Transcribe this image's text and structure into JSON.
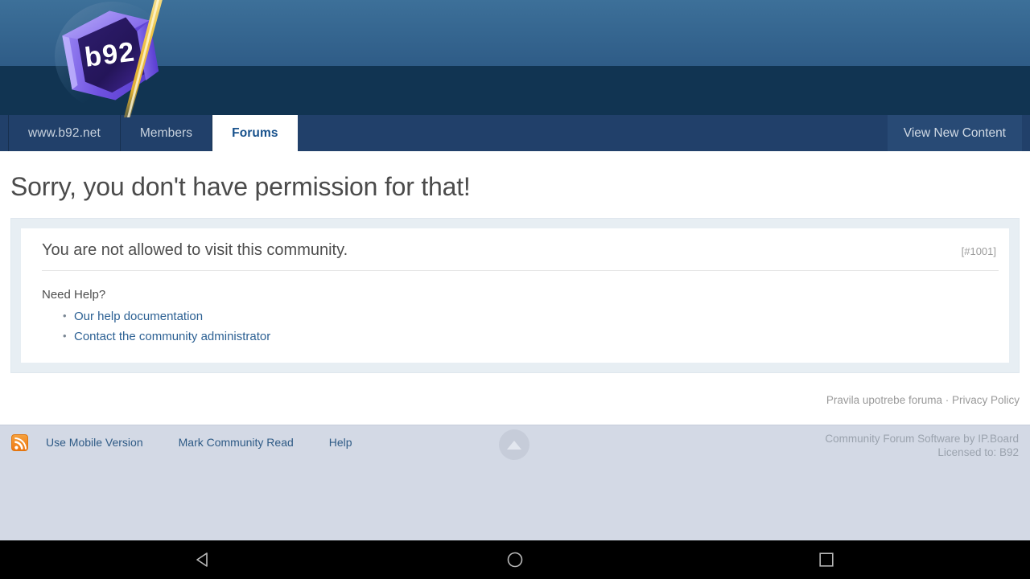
{
  "header": {
    "logo_alt": "b92-logo",
    "logo_text": "b92"
  },
  "nav": {
    "tabs": [
      {
        "label": "www.b92.net",
        "active": false,
        "name": "tab-www-b92-net"
      },
      {
        "label": "Members",
        "active": false,
        "name": "tab-members"
      },
      {
        "label": "Forums",
        "active": true,
        "name": "tab-forums"
      }
    ],
    "right_link": "View New Content"
  },
  "main": {
    "page_title": "Sorry, you don't have permission for that!",
    "message": {
      "title": "You are not allowed to visit this community.",
      "code": "[#1001]",
      "need_help_label": "Need Help?",
      "help_links": [
        "Our help documentation",
        "Contact the community administrator"
      ]
    },
    "policy": {
      "forum_rules": "Pravila upotrebe foruma",
      "separator": "·",
      "privacy": "Privacy Policy"
    }
  },
  "footer": {
    "rss_icon": "rss-icon",
    "links": [
      "Use Mobile Version",
      "Mark Community Read",
      "Help"
    ],
    "credit_line_1": "Community Forum Software by IP.Board",
    "credit_line_2": "Licensed to: B92",
    "scroll_top_icon": "arrow-up-icon"
  },
  "system_nav": {
    "back": "back-icon",
    "home": "home-icon",
    "recents": "recents-icon"
  },
  "colors": {
    "header_top": "#3d7099",
    "header_band": "#113452",
    "navbar": "#21406a",
    "active_tab_text": "#17518c",
    "link": "#2c6093",
    "page_bg": "#d7dce8",
    "footer_bg": "#d3d9e5",
    "rss_orange": "#ee7611"
  }
}
